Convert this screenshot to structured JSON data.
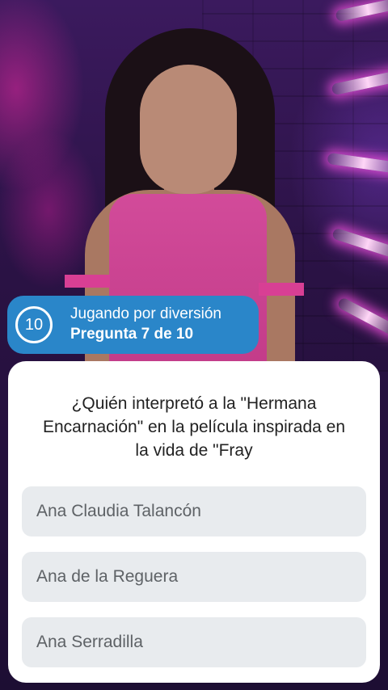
{
  "header": {
    "timer": "10",
    "mode": "Jugando por diversión",
    "progress": "Pregunta 7 de 10"
  },
  "quiz": {
    "question": "¿Quién interpretó a la \"Hermana Encarnación\" en la película inspirada en la vida de \"Fray",
    "options": [
      "Ana Claudia Talancón",
      "Ana de la Reguera",
      "Ana Serradilla"
    ]
  },
  "colors": {
    "accent": "#2a86c9",
    "option_bg": "#e8ebee",
    "option_text": "#5e6266"
  }
}
